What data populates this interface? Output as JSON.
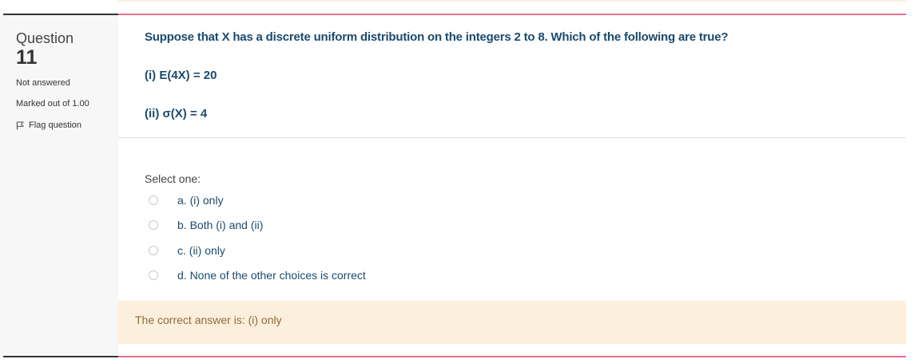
{
  "question": {
    "word": "Question",
    "number": "11",
    "state": "Not answered",
    "grade": "Marked out of 1.00",
    "flag_label": "Flag question"
  },
  "formulation": {
    "text": "Suppose that X has a discrete uniform distribution on the integers 2 to 8. Which of the following are true?",
    "statement1": "(i) E(4X) = 20",
    "statement2": "(ii) σ(X) = 4"
  },
  "answer": {
    "prompt": "Select one:",
    "options": [
      {
        "label": "a. (i) only"
      },
      {
        "label": "b. Both (i) and (ii)"
      },
      {
        "label": "c. (ii) only"
      },
      {
        "label": "d. None of the other choices is correct"
      }
    ]
  },
  "feedback": {
    "right_answer": "The correct answer is: (i) only"
  },
  "colors": {
    "question_text": "#1b4a6e",
    "feedback_bg": "#fcefdc",
    "feedback_text": "#8a6d3b",
    "divider_accent": "#e4708c"
  },
  "icons": {
    "flag": "flag-outline-icon"
  }
}
